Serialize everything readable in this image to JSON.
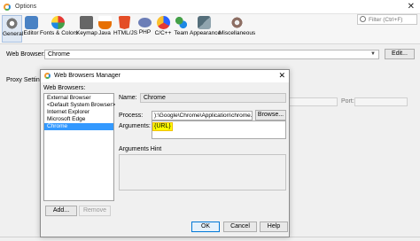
{
  "options_window": {
    "title": "Options",
    "close_glyph": "✕",
    "search_placeholder": "Filter (Ctrl+F)",
    "categories": [
      {
        "label": "General",
        "icon": "gear-icon",
        "selected": true
      },
      {
        "label": "Editor",
        "icon": "editor-icon",
        "selected": false
      },
      {
        "label": "Fonts & Colors",
        "icon": "color-wheel-icon",
        "selected": false
      },
      {
        "label": "Keymap",
        "icon": "keyboard-icon",
        "selected": false
      },
      {
        "label": "Java",
        "icon": "java-cup-icon",
        "selected": false
      },
      {
        "label": "HTML/JS",
        "icon": "html5-icon",
        "selected": false
      },
      {
        "label": "PHP",
        "icon": "php-icon",
        "selected": false
      },
      {
        "label": "C/C++",
        "icon": "cpp-icon",
        "selected": false
      },
      {
        "label": "Team",
        "icon": "team-icon",
        "selected": false
      },
      {
        "label": "Appearance",
        "icon": "appearance-icon",
        "selected": false
      },
      {
        "label": "Miscellaneous",
        "icon": "misc-gear-icon",
        "selected": false
      }
    ],
    "web_browser_label": "Web Browser:",
    "web_browser_value": "Chrome",
    "edit_button": "Edit...",
    "proxy_label": "Proxy Settings",
    "port_label": "Port:"
  },
  "dialog": {
    "title": "Web Browsers Manager",
    "close_glyph": "✕",
    "browsers_label": "Web Browsers:",
    "browsers": [
      {
        "label": "External Browser",
        "selected": false
      },
      {
        "label": "<Default System Browser>",
        "selected": false
      },
      {
        "label": "Internet Explorer",
        "selected": false
      },
      {
        "label": "Microsoft Edge",
        "selected": false
      },
      {
        "label": "Chrome",
        "selected": true
      }
    ],
    "add_button": "Add...",
    "remove_button": "Remove",
    "name_label": "Name:",
    "name_value": "Chrome",
    "process_label": "Process:",
    "process_value": "):\\Google\\Chrome\\Application\\chrome.exe",
    "browse_button": "Browse...",
    "arguments_label": "Arguments:",
    "arguments_value": "{URL}",
    "arguments_highlight_color": "#ffff00",
    "hint_label": "Arguments Hint",
    "ok_button": "OK",
    "cancel_button": "Cancel",
    "help_button": "Help"
  }
}
